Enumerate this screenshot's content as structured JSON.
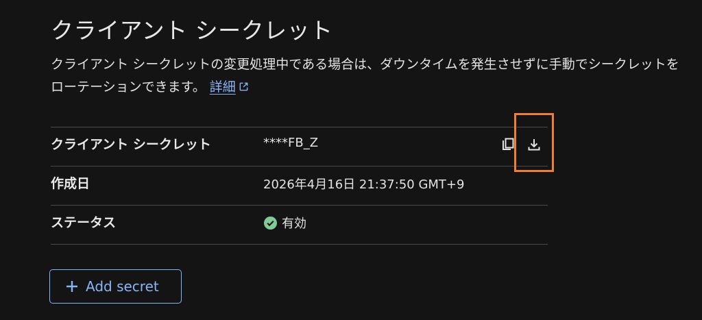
{
  "header": {
    "title": "クライアント シークレット"
  },
  "description": {
    "text": "クライアント シークレットの変更処理中である場合は、ダウンタイムを発生させずに手動でシークレットをローテーションできます。",
    "link_label": "詳細",
    "link_icon": "open-in-new-icon"
  },
  "details": {
    "rows": [
      {
        "label": "クライアント シークレット",
        "value": "****FB_Z"
      },
      {
        "label": "作成日",
        "value": "2026年4月16日 21:37:50 GMT+9"
      },
      {
        "label": "ステータス",
        "value": "有効",
        "status_icon": "check-circle-icon"
      }
    ],
    "actions": {
      "copy_icon": "copy-icon",
      "download_icon": "download-icon"
    }
  },
  "add_secret": {
    "label": "Add secret",
    "icon": "plus-icon"
  },
  "colors": {
    "background": "#141414",
    "accent": "#8ab4f8",
    "success": "#81c995",
    "highlight": "#f07f2f",
    "divider": "#4a4a4a"
  }
}
